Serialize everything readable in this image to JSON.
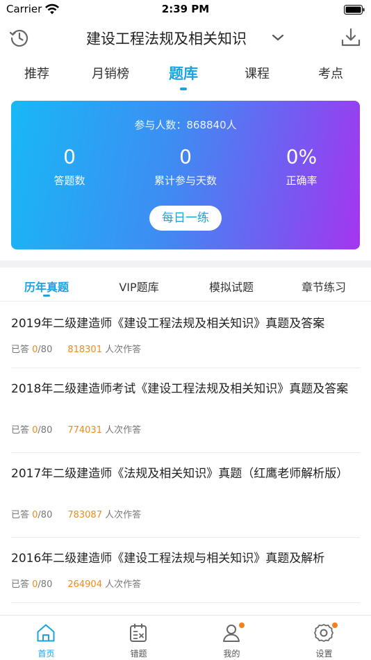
{
  "status_bar": {
    "carrier": "Carrier",
    "time": "2:39 PM"
  },
  "nav": {
    "title": "建设工程法规及相关知识"
  },
  "top_tabs": [
    {
      "label": "推荐",
      "active": false
    },
    {
      "label": "月销榜",
      "active": false
    },
    {
      "label": "题库",
      "active": true
    },
    {
      "label": "课程",
      "active": false
    },
    {
      "label": "考点",
      "active": false
    }
  ],
  "hero": {
    "participants": "参与人数：868840人",
    "stats": [
      {
        "value": "0",
        "label": "答题数"
      },
      {
        "value": "0",
        "label": "累计参与天数"
      },
      {
        "value": "0%",
        "label": "正确率"
      }
    ],
    "daily_button": "每日一练"
  },
  "sub_tabs": [
    {
      "label": "历年真题",
      "active": true
    },
    {
      "label": "VIP题库",
      "active": false
    },
    {
      "label": "模拟试题",
      "active": false
    },
    {
      "label": "章节练习",
      "active": false
    }
  ],
  "exams": [
    {
      "title": "2019年二级建造师《建设工程法规及相关知识》真题及答案",
      "answered_prefix": "已答 ",
      "answered": "0",
      "total": "/80",
      "attempts": "818301",
      "attempts_suffix": " 人次作答"
    },
    {
      "title": "2018年二级建造师考试《建设工程法规及相关知识》真题及答案",
      "answered_prefix": "已答 ",
      "answered": "0",
      "total": "/80",
      "attempts": "774031",
      "attempts_suffix": " 人次作答"
    },
    {
      "title": "2017年二级建造师《法规及相关知识》真题（红鹰老师解析版）",
      "answered_prefix": "已答 ",
      "answered": "0",
      "total": "/80",
      "attempts": "783087",
      "attempts_suffix": " 人次作答"
    },
    {
      "title": "2016年二级建造师《建设工程法规与相关知识》真题及解析",
      "answered_prefix": "已答 ",
      "answered": "0",
      "total": "/80",
      "attempts": "264904",
      "attempts_suffix": " 人次作答"
    }
  ],
  "tab_bar": [
    {
      "label": "首页",
      "icon": "home-icon",
      "active": true,
      "badge": false
    },
    {
      "label": "错题",
      "icon": "wrong-questions-icon",
      "active": false,
      "badge": false
    },
    {
      "label": "我的",
      "icon": "profile-icon",
      "active": false,
      "badge": true
    },
    {
      "label": "设置",
      "icon": "settings-icon",
      "active": false,
      "badge": true
    }
  ],
  "colors": {
    "accent": "#1aa3e0",
    "highlight": "#f08a1c",
    "badge": "#f5801e",
    "gradient_start": "#18b8f5",
    "gradient_end": "#a535f0"
  }
}
